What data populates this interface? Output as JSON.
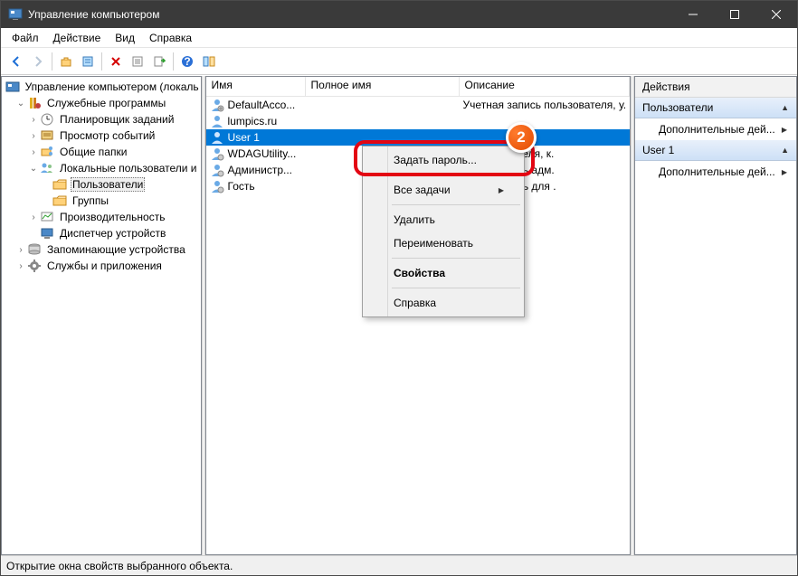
{
  "window": {
    "title": "Управление компьютером"
  },
  "menubar": {
    "file": "Файл",
    "action": "Действие",
    "view": "Вид",
    "help": "Справка"
  },
  "tree": {
    "root": "Управление компьютером (локаль",
    "sys_tools": "Служебные программы",
    "task_sched": "Планировщик заданий",
    "event_viewer": "Просмотр событий",
    "shared": "Общие папки",
    "local_users": "Локальные пользователи и",
    "users": "Пользователи",
    "groups": "Группы",
    "perf": "Производительность",
    "devmgr": "Диспетчер устройств",
    "storage": "Запоминающие устройства",
    "services": "Службы и приложения"
  },
  "list": {
    "col_name": "Имя",
    "col_fullname": "Полное имя",
    "col_desc": "Описание",
    "rows": [
      {
        "name": "DefaultAcco...",
        "full": "",
        "desc": "Учетная запись пользователя, у."
      },
      {
        "name": "lumpics.ru",
        "full": "",
        "desc": ""
      },
      {
        "name": "User 1",
        "full": "",
        "desc": ""
      },
      {
        "name": "WDAGUtility...",
        "full": "",
        "desc": "ь пользователя, к."
      },
      {
        "name": "Администр...",
        "full": "",
        "desc": "етная запись адм."
      },
      {
        "name": "Гость",
        "full": "",
        "desc": "етная запись для ."
      }
    ]
  },
  "ctx": {
    "set_password": "Задать пароль...",
    "all_tasks": "Все задачи",
    "delete": "Удалить",
    "rename": "Переименовать",
    "properties": "Свойства",
    "help": "Справка"
  },
  "actions": {
    "header": "Действия",
    "sec_users": "Пользователи",
    "more": "Дополнительные дей...",
    "sec_user1": "User 1"
  },
  "annotation": {
    "step": "2"
  },
  "status": {
    "text": "Открытие окна свойств выбранного объекта."
  }
}
